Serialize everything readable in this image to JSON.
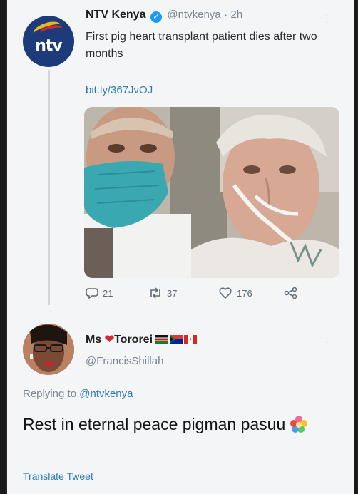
{
  "tweet": {
    "author_name": "NTV Kenya",
    "author_handle": "@ntvkenya",
    "separator": "·",
    "time": "2h",
    "avatar_text": "ntv",
    "text": "First pig heart transplant patient dies after two months",
    "link": "bit.ly/367JvOJ",
    "replies": "21",
    "retweets": "37",
    "likes": "176"
  },
  "reply": {
    "name_prefix": "Ms",
    "name_suffix": "Tororei",
    "handle": "@FrancisShillah",
    "replying_label": "Replying to",
    "replying_to": "@ntvkenya",
    "text": "Rest in eternal peace pigman pasuu",
    "translate": "Translate Tweet"
  },
  "colors": {
    "link_blue": "#2f7ab8",
    "verified_blue": "#1d9bf0",
    "heart_red": "#d6283b",
    "mask_teal": "#3aa8b0"
  },
  "icons": [
    "verified-icon",
    "more-icon",
    "reply-icon",
    "retweet-icon",
    "like-icon",
    "share-icon",
    "heart-emoji-icon",
    "flag-icon",
    "flower-emoji-icon"
  ]
}
